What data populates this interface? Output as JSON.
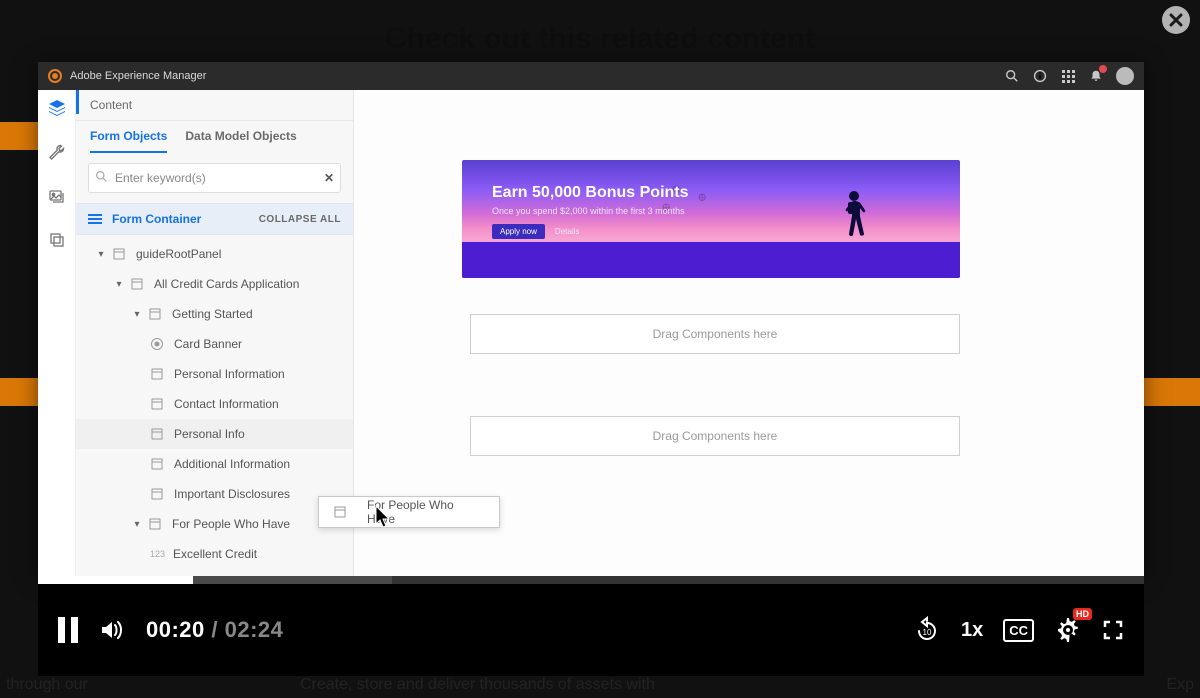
{
  "backdrop": {
    "heading": "Check out this related content",
    "footer_left": "through our",
    "footer_mid": "Create, store and deliver thousands of assets with",
    "footer_right": "Exp"
  },
  "titlebar": {
    "product": "Adobe Experience Manager"
  },
  "sidebar": {
    "heading": "Content",
    "tabs": {
      "form_objects": "Form Objects",
      "data_model": "Data Model Objects"
    },
    "search_placeholder": "Enter keyword(s)",
    "container_label": "Form Container",
    "collapse_label": "COLLAPSE ALL",
    "tree": {
      "root": "guideRootPanel",
      "app": "All Credit Cards Application",
      "getting_started": "Getting Started",
      "items": {
        "card_banner": "Card Banner",
        "personal_info": "Personal Information",
        "contact_info": "Contact Information",
        "personal_info2": "Personal Info",
        "additional_info": "Additional Information",
        "disclosures": "Important Disclosures"
      },
      "for_people": "For People Who Have",
      "excellent": "Excellent Credit",
      "tag123": "123"
    }
  },
  "banner": {
    "title": "Earn 50,000 Bonus Points",
    "sub": "Once you spend $2,000 within the first 3 months",
    "cta1": "Apply now",
    "cta2": "Details"
  },
  "canvas": {
    "drop_label": "Drag Components here"
  },
  "drag": {
    "label": "For People Who Have"
  },
  "player": {
    "current": "00:20",
    "sep": " / ",
    "duration": "02:24",
    "rate": "1x",
    "cc": "CC",
    "hd": "HD",
    "progress_pct": 14,
    "buffer_pct": 32
  }
}
